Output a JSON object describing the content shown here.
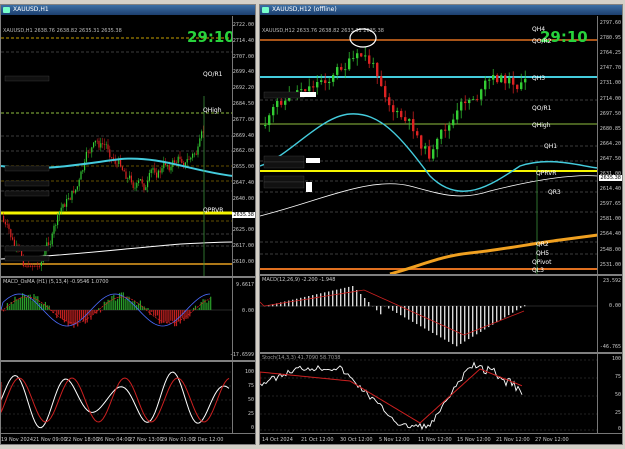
{
  "left": {
    "title": "XAUUSD,H1",
    "ohlc": "XAUUSD,H1 2638.76 2638.82 2635.31 2635.38",
    "timer": "29:10",
    "y_labels": [
      "2722.00",
      "2714.40",
      "2707.00",
      "2699.40",
      "2692.20",
      "2684.50",
      "2677.00",
      "2669.40",
      "2662.00",
      "2655.00",
      "2647.40",
      "2640.00",
      "2632.40",
      "2625.00",
      "2617.00",
      "2610.00"
    ],
    "levels": {
      "q_or1": "QO/R1",
      "q_high": "QHigh",
      "q_prvr": "QPRVR"
    },
    "price_tag": "2635.38",
    "macd_label": "MACD_OsMA (H1) (5,13,4) -0.9546 1.0700",
    "macd_y": [
      "9.6617",
      "0.00",
      "-17.6599"
    ],
    "stoch_y": [
      "100",
      "75",
      "50",
      "25",
      "0"
    ],
    "x_labels": [
      "19 Nov 2024",
      "21 Nov 09:00",
      "22 Nov 18:00",
      "26 Nov 04:00",
      "27 Nov 13:00",
      "29 Nov 01:00",
      "2 Dec 12:00"
    ]
  },
  "right": {
    "title": "XAUUSD,H12 (offline)",
    "ohlc": "XAUUSD,H12 2633.76 2638.82 2633.31 2635.38",
    "timer": "29:10",
    "y_labels": [
      "2797.60",
      "2780.95",
      "2764.25",
      "2747.70",
      "2731.00",
      "2714.00",
      "2697.50",
      "2680.85",
      "2664.20",
      "2647.50",
      "2631.00",
      "2614.40",
      "2597.65",
      "2581.00",
      "2564.40",
      "2548.00",
      "2531.00"
    ],
    "levels": {
      "qh4": "QH4",
      "qo_r2": "QO/R2",
      "qh3": "QH3",
      "qo_r1": "QO/R1",
      "qhigh": "QHigh",
      "qh1": "QH1",
      "qprvr": "QPRVR",
      "qr3": "QR3",
      "qr2": "QR2",
      "qh5": "QH5",
      "qpivot": "QPivot",
      "ql3": "QL3"
    },
    "price_tag": "2635.38",
    "macd_label": "MACD(12,26,9) -2.200 -1.948",
    "macd_y": [
      "23.592",
      "0.00",
      "-46.765"
    ],
    "stoch_label": "Stoch(14,3,3) 41.7090 58.7038",
    "stoch_y": [
      "100",
      "75",
      "50",
      "25",
      "0"
    ],
    "x_labels": [
      "14 Oct 2024",
      "21 Oct 12:00",
      "30 Oct 12:00",
      "5 Nov 12:00",
      "11 Nov 12:00",
      "15 Nov 12:00",
      "21 Nov 12:00",
      "27 Nov 12:00"
    ]
  }
}
